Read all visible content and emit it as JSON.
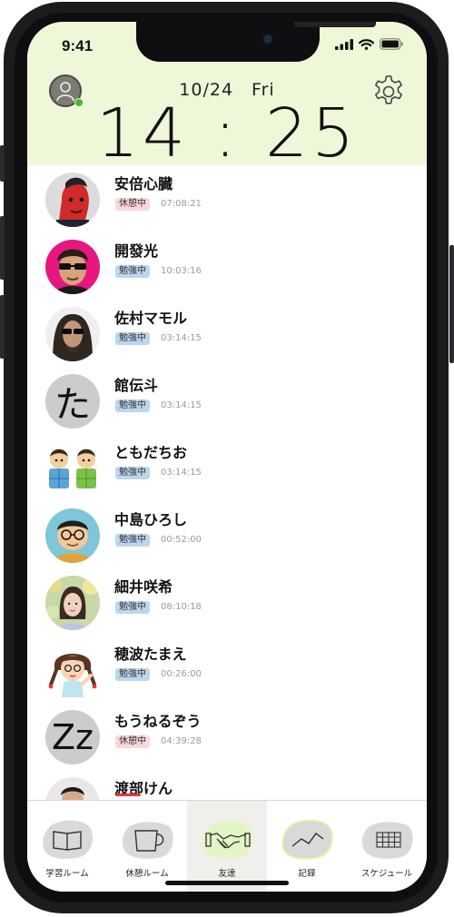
{
  "status_bar": {
    "time": "9:41"
  },
  "header": {
    "date": "10/24　Fri",
    "clock": "14 : 25"
  },
  "friends": [
    {
      "name": "安倍心臓",
      "status": "休憩中",
      "status_kind": "rest",
      "elapsed": "07:08:21",
      "avatar": "photo-red-face"
    },
    {
      "name": "開發光",
      "status": "勉強中",
      "status_kind": "study",
      "elapsed": "10:03:16",
      "avatar": "photo-sunglasses-pink"
    },
    {
      "name": "佐村マモル",
      "status": "勉強中",
      "status_kind": "study",
      "elapsed": "03:14:15",
      "avatar": "photo-long-hair-sunglasses"
    },
    {
      "name": "館伝斗",
      "status": "勉強中",
      "status_kind": "study",
      "elapsed": "03:14:15",
      "avatar": "letter",
      "avatar_text": "た"
    },
    {
      "name": "ともだちお",
      "status": "勉強中",
      "status_kind": "study",
      "elapsed": "03:14:15",
      "avatar": "illustration-two-kids"
    },
    {
      "name": "中島ひろし",
      "status": "勉強中",
      "status_kind": "study",
      "elapsed": "00:52:00",
      "avatar": "illustration-boy-glasses"
    },
    {
      "name": "細井咲希",
      "status": "勉強中",
      "status_kind": "study",
      "elapsed": "08:10:18",
      "avatar": "photo-woman-flowers"
    },
    {
      "name": "穂波たまえ",
      "status": "勉強中",
      "status_kind": "study",
      "elapsed": "00:26:00",
      "avatar": "illustration-girl-braids"
    },
    {
      "name": "もうねるぞう",
      "status": "休憩中",
      "status_kind": "rest",
      "elapsed": "04:39:28",
      "avatar": "letter",
      "avatar_text": "Zz"
    },
    {
      "name": "渡部けん",
      "status": "",
      "status_kind": "rest",
      "elapsed": "",
      "avatar": "photo-man-partial"
    }
  ],
  "tabs": [
    {
      "label": "学習ルーム",
      "icon": "book-icon",
      "active": false
    },
    {
      "label": "休憩ルーム",
      "icon": "cup-icon",
      "active": false
    },
    {
      "label": "友達",
      "icon": "handshake-icon",
      "active": true
    },
    {
      "label": "記録",
      "icon": "chart-line-icon",
      "active": false
    },
    {
      "label": "スケジュール",
      "icon": "calendar-grid-icon",
      "active": false
    }
  ],
  "colors": {
    "header_bg": "#eef8d8",
    "study_badge": "#bcd6ee",
    "rest_badge": "#fbd7db",
    "online": "#3bbf2b",
    "active_tab_bg": "#f1efec",
    "active_blob": "#e2f5c4"
  }
}
